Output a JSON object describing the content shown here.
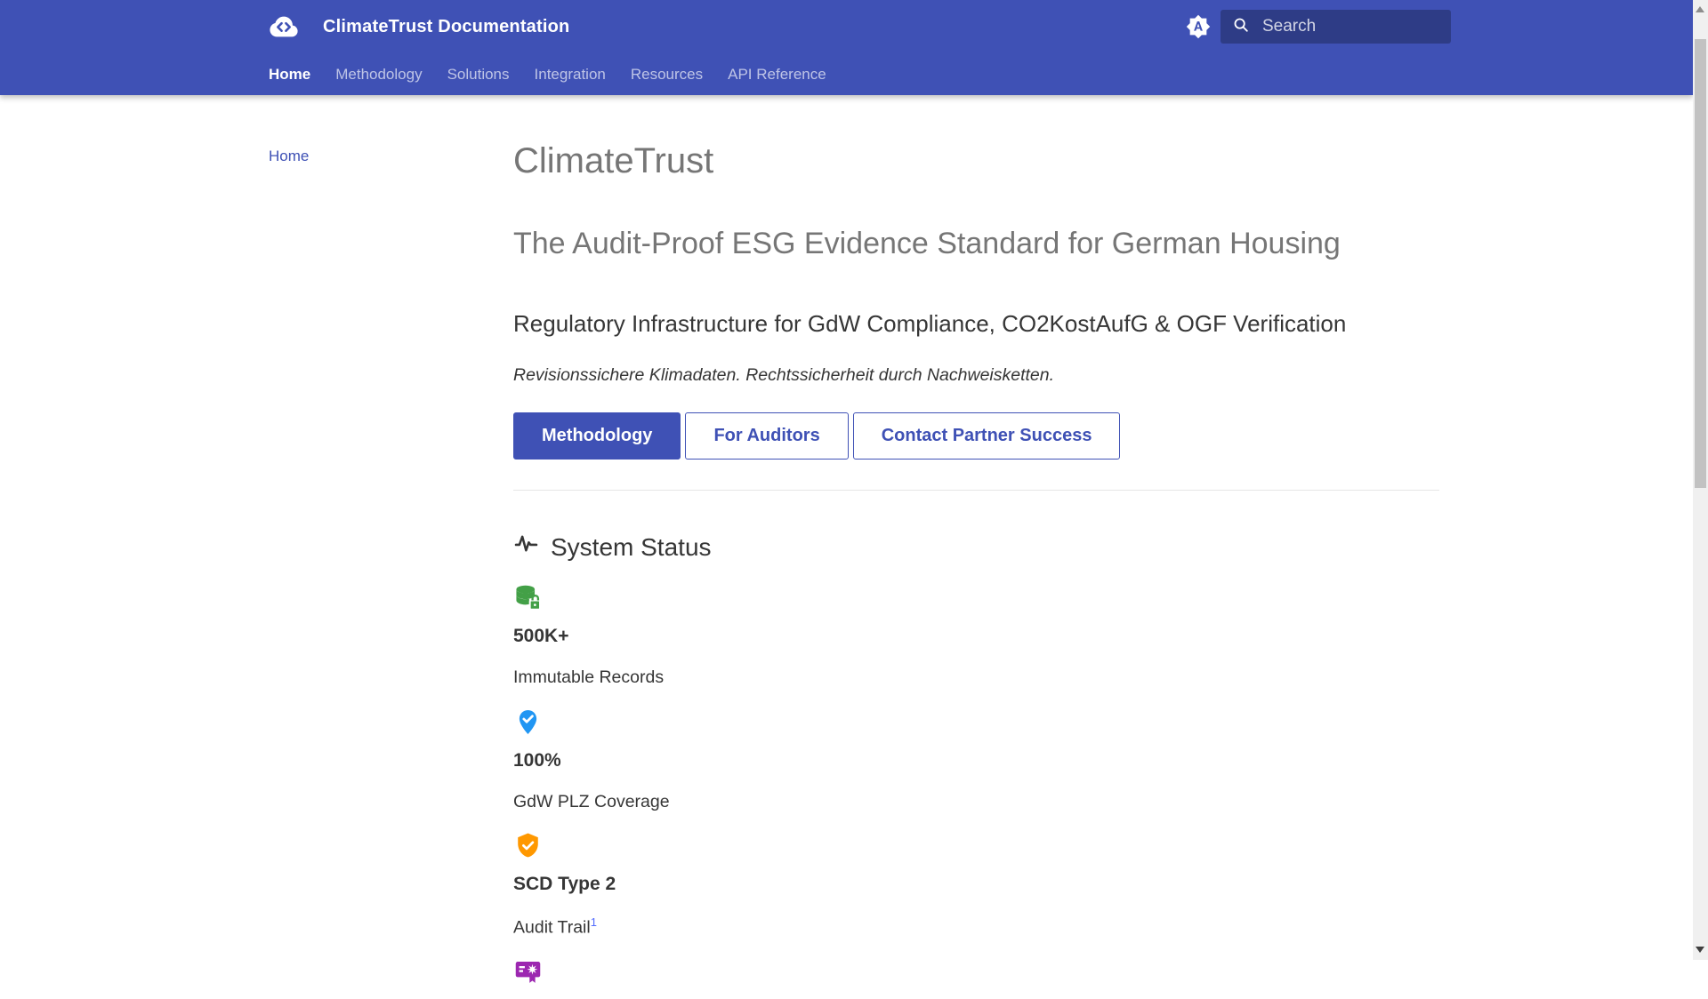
{
  "theme": {
    "primary_color": "#3f51b5",
    "header_text_color": "#ffffff",
    "muted_heading_color": "#767676",
    "body_text_color": "#363636",
    "footnote_link_color": "#526cfe"
  },
  "header": {
    "title": "ClimateTrust Documentation",
    "logo_icon": "cloud-code-icon",
    "theme_toggle_icon": "brightness-auto-icon",
    "search": {
      "icon": "search-icon",
      "placeholder": "Search"
    },
    "tabs": [
      {
        "label": "Home",
        "active": true
      },
      {
        "label": "Methodology",
        "active": false
      },
      {
        "label": "Solutions",
        "active": false
      },
      {
        "label": "Integration",
        "active": false
      },
      {
        "label": "Resources",
        "active": false
      },
      {
        "label": "API Reference",
        "active": false
      }
    ]
  },
  "sidebar": {
    "items": [
      {
        "label": "Home",
        "active": true
      }
    ]
  },
  "main": {
    "page_title": "ClimateTrust",
    "tagline": "The Audit-Proof ESG Evidence Standard for German Housing",
    "subheading": "Regulatory Infrastructure for GdW Compliance, CO2KostAufG & OGF Verification",
    "lead": "Revisionssichere Klimadaten. Rechtssicherheit durch Nachweisketten.",
    "buttons": [
      {
        "label": "Methodology",
        "style": "primary"
      },
      {
        "label": "For Auditors",
        "style": "outline"
      },
      {
        "label": "Contact Partner Success",
        "style": "outline"
      }
    ],
    "status": {
      "title": "System Status",
      "icon": "pulse-icon",
      "stats": [
        {
          "icon": "database-lock-icon",
          "color": "#43a047",
          "value": "500K+",
          "label": "Immutable Records"
        },
        {
          "icon": "map-marker-check-icon",
          "color": "#2196f3",
          "value": "100%",
          "label": "GdW PLZ Coverage"
        },
        {
          "icon": "shield-check-icon",
          "color": "#ff9800",
          "value": "SCD Type 2",
          "label": "Audit Trail",
          "footnote": "1"
        },
        {
          "icon": "certificate-icon",
          "color": "#9c27b0"
        }
      ]
    }
  }
}
